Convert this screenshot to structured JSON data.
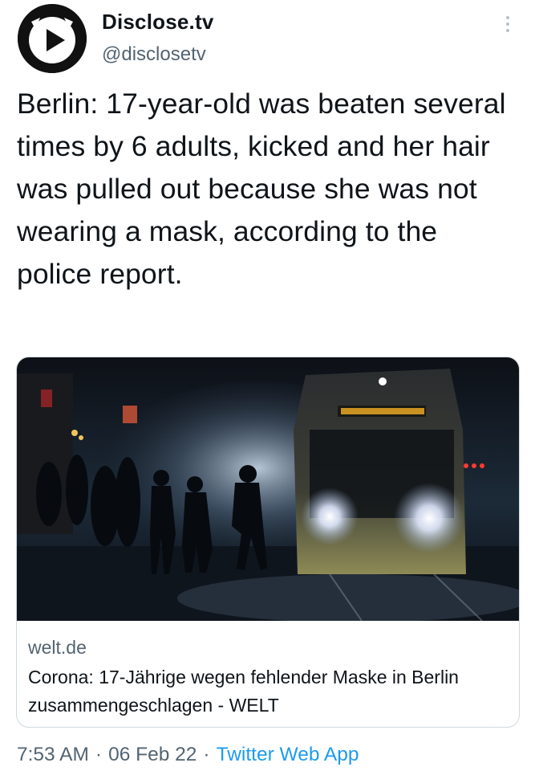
{
  "tweet": {
    "author": {
      "display_name": "Disclose.tv",
      "handle": "@disclosetv",
      "avatar_icon": "play-cat-logo-icon"
    },
    "menu_icon": "more-vertical-icon",
    "text": "Berlin: 17-year-old was beaten several times by 6 adults, kicked and her hair was pulled out because she was not wearing a mask, according to the police report.",
    "link_card": {
      "domain": "welt.de",
      "title": "Corona: 17-Jährige wegen fehlender Maske in Berlin zusammengeschlagen - WELT"
    },
    "time": "7:53 AM",
    "separator": "·",
    "date": "06 Feb 22",
    "source": "Twitter Web App"
  },
  "colors": {
    "text_primary": "#0f1419",
    "text_secondary": "#536471",
    "link": "#1d9bf0",
    "card_border": "#cfd9de"
  }
}
